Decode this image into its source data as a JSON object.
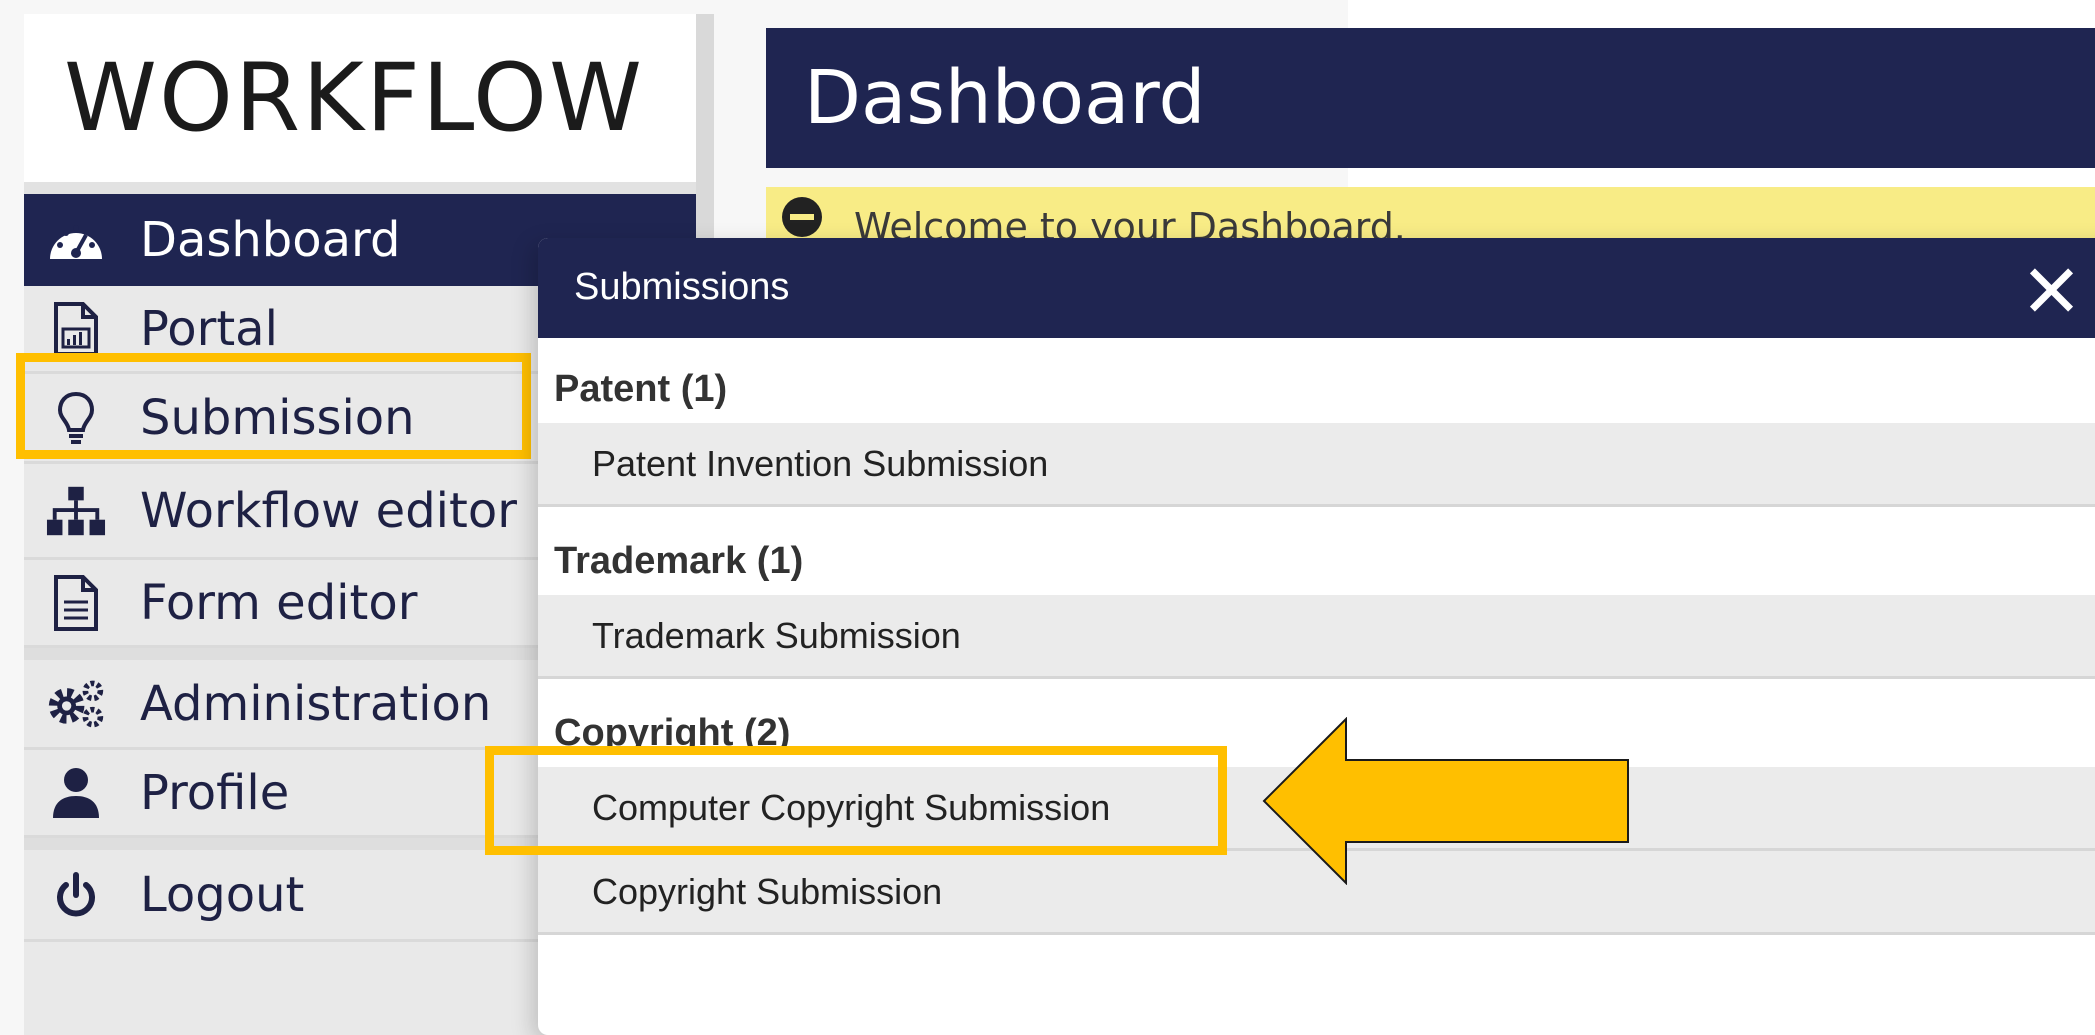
{
  "app": {
    "brand": "WORKFLOW"
  },
  "sidebar": {
    "items": [
      {
        "label": "Dashboard",
        "icon": "dashboard-gauge-icon"
      },
      {
        "label": "Portal",
        "icon": "chart-document-icon"
      },
      {
        "label": "Submission",
        "icon": "lightbulb-icon"
      },
      {
        "label": "Workflow editor",
        "icon": "sitemap-icon"
      },
      {
        "label": "Form editor",
        "icon": "document-icon"
      },
      {
        "label": "Administration",
        "icon": "gears-icon"
      },
      {
        "label": "Profile",
        "icon": "user-icon"
      },
      {
        "label": "Logout",
        "icon": "power-icon"
      }
    ]
  },
  "main": {
    "title": "Dashboard",
    "welcome": "Welcome to your Dashboard."
  },
  "modal": {
    "title": "Submissions",
    "groups": [
      {
        "heading": "Patent (1)",
        "items": [
          "Patent Invention Submission"
        ]
      },
      {
        "heading": "Trademark (1)",
        "items": [
          "Trademark Submission"
        ]
      },
      {
        "heading": "Copyright (2)",
        "items": [
          "Computer Copyright Submission",
          "Copyright Submission"
        ]
      }
    ]
  },
  "colors": {
    "navy": "#1f2551",
    "highlight": "#ffbf00",
    "welcome_bg": "#f8ec86"
  }
}
